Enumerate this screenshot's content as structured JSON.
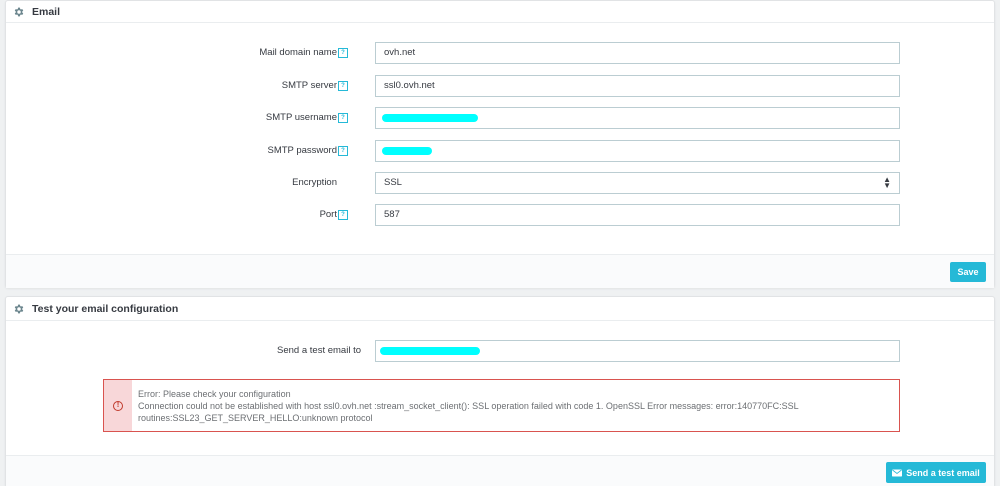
{
  "email_panel": {
    "title": "Email",
    "fields": {
      "mail_domain": {
        "label": "Mail domain name",
        "value": "ovh.net"
      },
      "smtp_server": {
        "label": "SMTP server",
        "value": "ssl0.ovh.net"
      },
      "smtp_username": {
        "label": "SMTP username",
        "value": ""
      },
      "smtp_password": {
        "label": "SMTP password",
        "value": ""
      },
      "encryption": {
        "label": "Encryption",
        "value": "SSL"
      },
      "port": {
        "label": "Port",
        "value": "587"
      }
    },
    "save_label": "Save"
  },
  "test_panel": {
    "title": "Test your email configuration",
    "send_to_label": "Send a test email to",
    "send_to_value": "",
    "error_title": "Error: Please check your configuration",
    "error_message": "Connection could not be established with host ssl0.ovh.net :stream_socket_client(): SSL operation failed with code 1. OpenSSL Error messages: error:140770FC:SSL routines:SSL23_GET_SERVER_HELLO:unknown protocol",
    "send_button_label": "Send a test email"
  },
  "colors": {
    "accent": "#25b9d7",
    "error_border": "#d9534f",
    "redaction": "#00ffff"
  },
  "icons": [
    "gear-icon",
    "help-icon",
    "select-arrows-icon",
    "error-icon",
    "envelope-icon"
  ]
}
